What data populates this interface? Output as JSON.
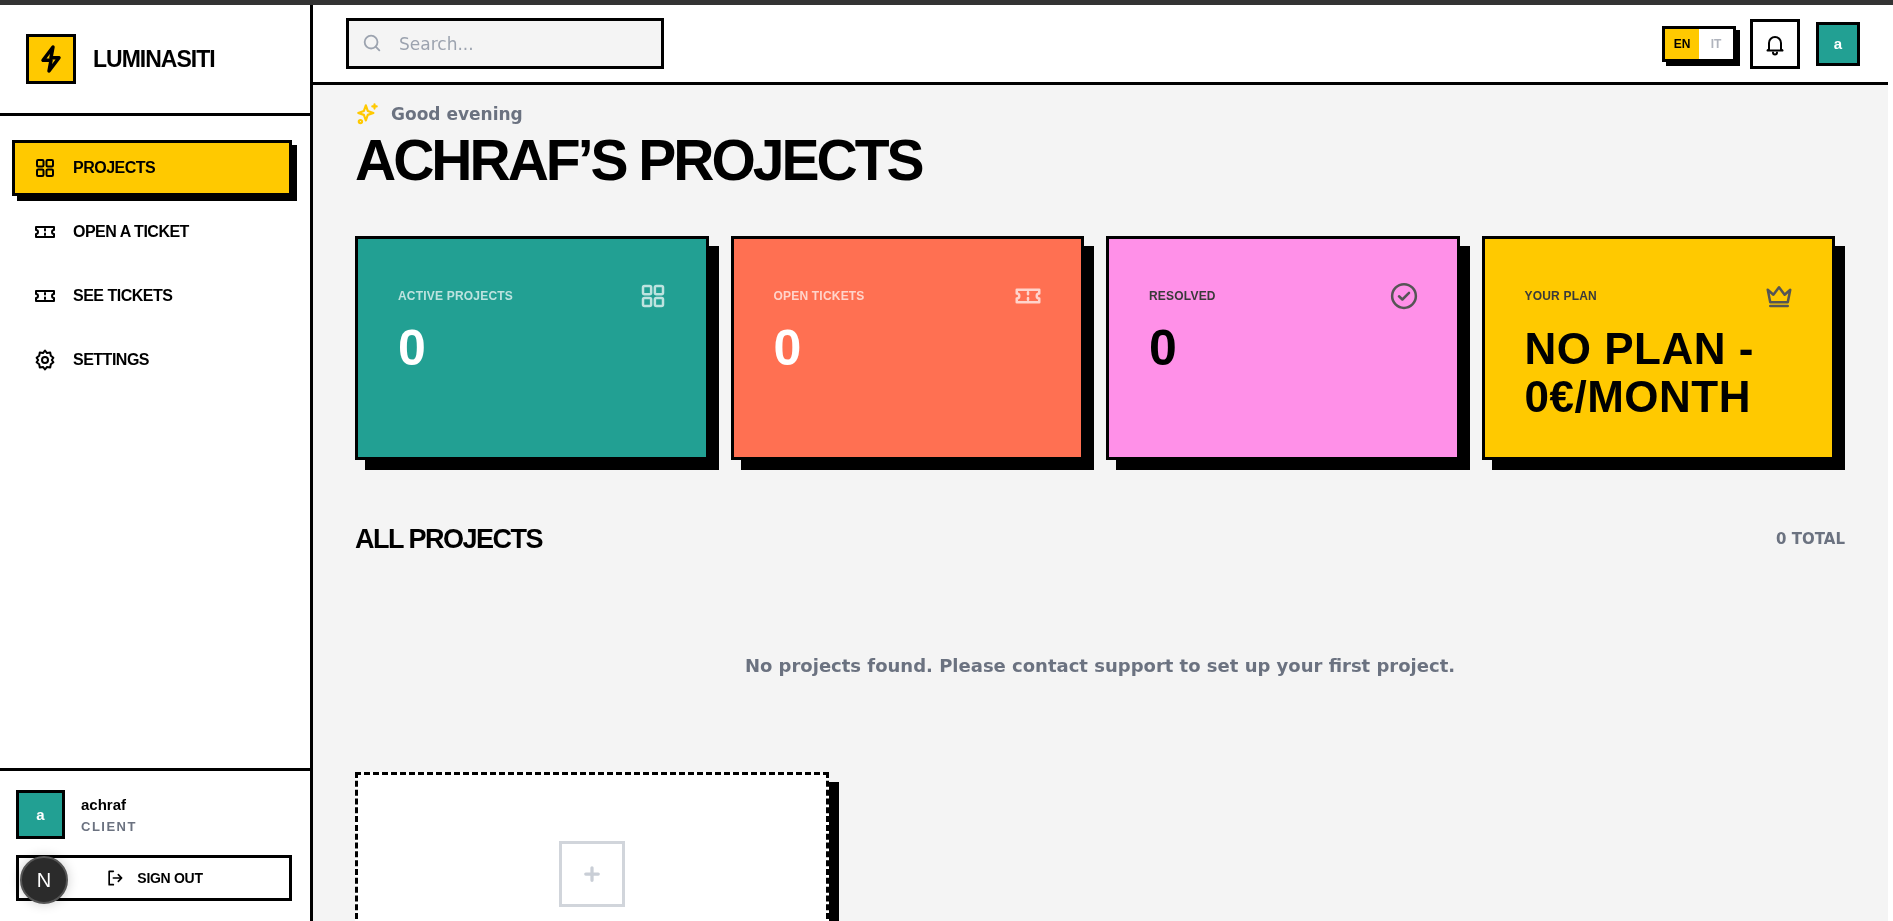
{
  "sidebar": {
    "logo": "LUMINASITI",
    "items": [
      {
        "label": "PROJECTS",
        "selected": true
      },
      {
        "label": "OPEN A TICKET",
        "selected": false
      },
      {
        "label": "SEE TICKETS",
        "selected": false
      },
      {
        "label": "SETTINGS",
        "selected": false
      }
    ],
    "user": {
      "avatar": "a",
      "name": "achraf",
      "role": "CLIENT"
    },
    "sign_out": "SIGN OUT",
    "dev_badge": "N"
  },
  "header": {
    "search": {
      "placeholder": "Search..."
    },
    "languages": [
      {
        "label": "EN",
        "selected": true
      },
      {
        "label": "IT",
        "selected": false
      }
    ],
    "avatar": "a"
  },
  "greeting": "Good evening",
  "title": "ACHRAF’S PROJECTS",
  "stats": [
    {
      "label": "ACTIVE PROJECTS",
      "value": "0",
      "color": "#22a093"
    },
    {
      "label": "OPEN TICKETS",
      "value": "0",
      "color": "#ff7052"
    },
    {
      "label": "RESOLVED",
      "value": "0",
      "color": "#ff90e8"
    },
    {
      "label": "YOUR PLAN",
      "value": "NO PLAN - 0€/MONTH",
      "color": "#ffc900"
    }
  ],
  "projects": {
    "heading": "ALL PROJECTS",
    "total": "0 TOTAL",
    "empty_message": "No projects found. Please contact support to set up your first project."
  }
}
